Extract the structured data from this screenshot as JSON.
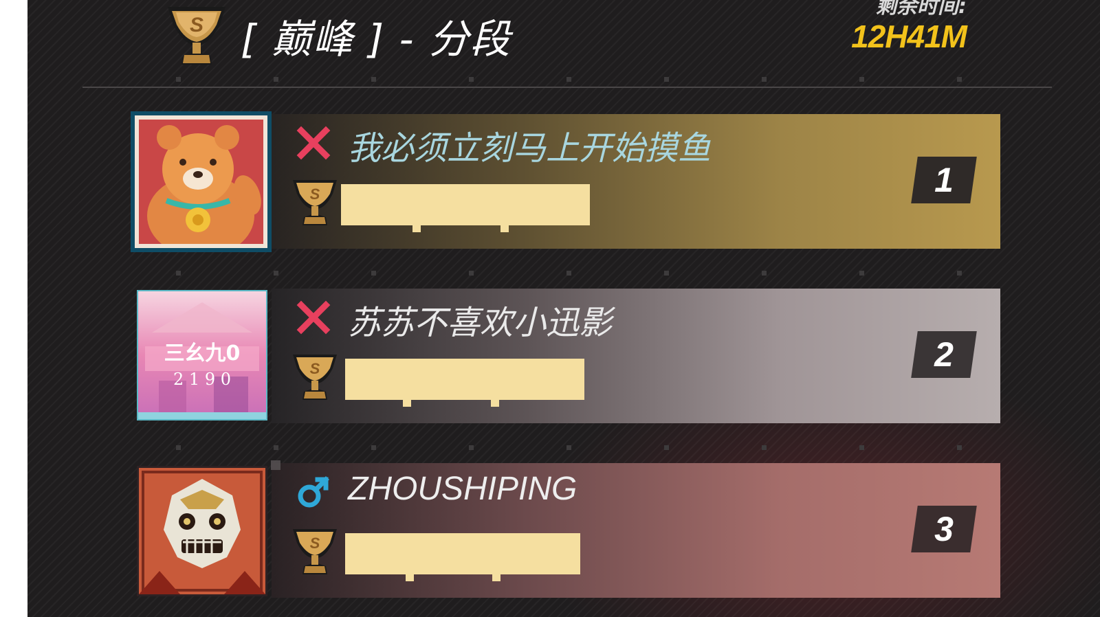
{
  "header": {
    "tier_title": "[ 巅峰 ] - 分段",
    "tier_trophy_letter": "S",
    "time_remaining_label": "剩余时间:",
    "time_remaining_value": "12H41M"
  },
  "leaderboard": [
    {
      "rank": "1",
      "name": "我必须立刻马上开始摸鱼",
      "status_icon": "cross-icon",
      "trophy_letter": "S",
      "avatar": "teddy-bear-avatar"
    },
    {
      "rank": "2",
      "name": "苏苏不喜欢小迅影",
      "status_icon": "cross-icon",
      "trophy_letter": "S",
      "avatar": "pink-city-avatar"
    },
    {
      "rank": "3",
      "name": "ZHOUSHIPING",
      "status_icon": "male-icon",
      "trophy_letter": "S",
      "avatar": "lion-mask-avatar"
    }
  ],
  "colors": {
    "time_accent": "#f2c21b",
    "cross_icon": "#e8405e",
    "male_icon": "#2fa8d8",
    "redacted_score": "#f5dfa0"
  }
}
